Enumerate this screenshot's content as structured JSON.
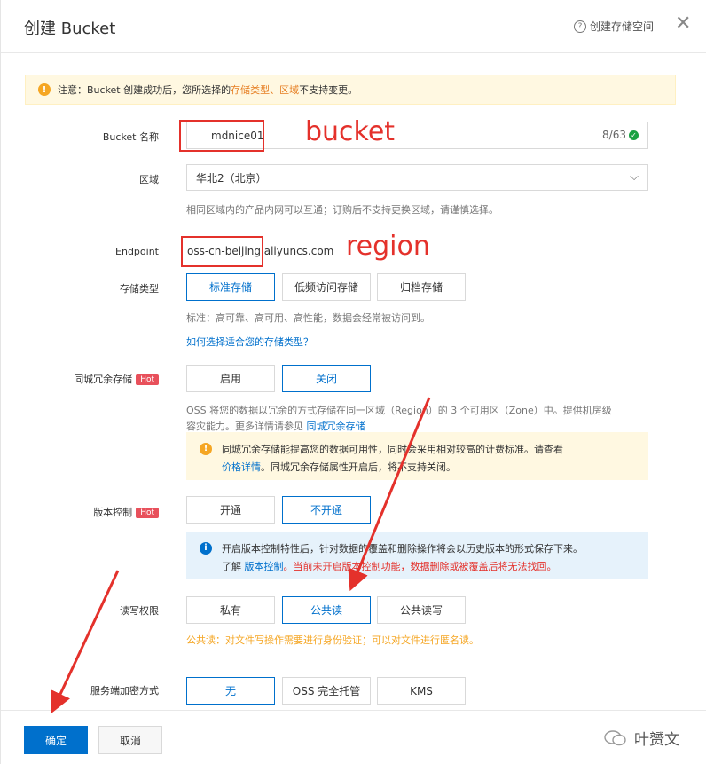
{
  "header": {
    "title": "创建 Bucket",
    "help_label": "创建存储空间"
  },
  "notice": {
    "prefix": "注意：Bucket 创建成功后，您所选择的",
    "highlight": "存储类型、区域",
    "suffix": "不支持变更。"
  },
  "bucket_name": {
    "label": "Bucket 名称",
    "value": "mdnice01",
    "counter": "8/63"
  },
  "region": {
    "label": "区域",
    "value": "华北2（北京）",
    "help": "相同区域内的产品内网可以互通；订购后不支持更换区域，请谨慎选择。"
  },
  "endpoint": {
    "label": "Endpoint",
    "value": "oss-cn-beijing.aliyuncs.com"
  },
  "storage_class": {
    "label": "存储类型",
    "options": [
      "标准存储",
      "低频访问存储",
      "归档存储"
    ],
    "selected": "标准存储",
    "help": "标准：高可靠、高可用、高性能，数据会经常被访问到。",
    "link": "如何选择适合您的存储类型？"
  },
  "zone_redundancy": {
    "label": "同城冗余存储",
    "hot": "Hot",
    "options": [
      "启用",
      "关闭"
    ],
    "selected": "关闭",
    "help_line1": "OSS 将您的数据以冗余的方式存储在同一区域（Region）的 3 个可用区（Zone）中。提供机房级",
    "help_line2": "容灾能力。更多详情请参见",
    "help_link": "同城冗余存储",
    "warn_line1": "同城冗余存储能提高您的数据可用性，同时会采用相对较高的计费标准。请查看",
    "warn_link": "价格详情",
    "warn_line2": "。同城冗余存储属性开启后，将不支持关闭。"
  },
  "versioning": {
    "label": "版本控制",
    "hot": "Hot",
    "options": [
      "开通",
      "不开通"
    ],
    "selected": "不开通",
    "info_line1": "开启版本控制特性后，针对数据的覆盖和删除操作将会以历史版本的形式保存下来。",
    "info_prefix": "了解",
    "info_link": "版本控制",
    "info_warn": "。当前未开启版本控制功能，数据删除或被覆盖后将无法找回。"
  },
  "acl": {
    "label": "读写权限",
    "options": [
      "私有",
      "公共读",
      "公共读写"
    ],
    "selected": "公共读",
    "warn": "公共读：对文件写操作需要进行身份验证；可以对文件进行匿名读。"
  },
  "encryption": {
    "label": "服务端加密方式",
    "options": [
      "无",
      "OSS 完全托管",
      "KMS"
    ],
    "selected": "无"
  },
  "footer": {
    "confirm": "确定",
    "cancel": "取消",
    "watermark": "叶赟文"
  },
  "annotations": {
    "bucket": "bucket",
    "region": "region"
  },
  "colors": {
    "primary": "#0070cc",
    "annotation": "#e4312b",
    "warn": "#f5a623",
    "hot": "#e8505b"
  }
}
